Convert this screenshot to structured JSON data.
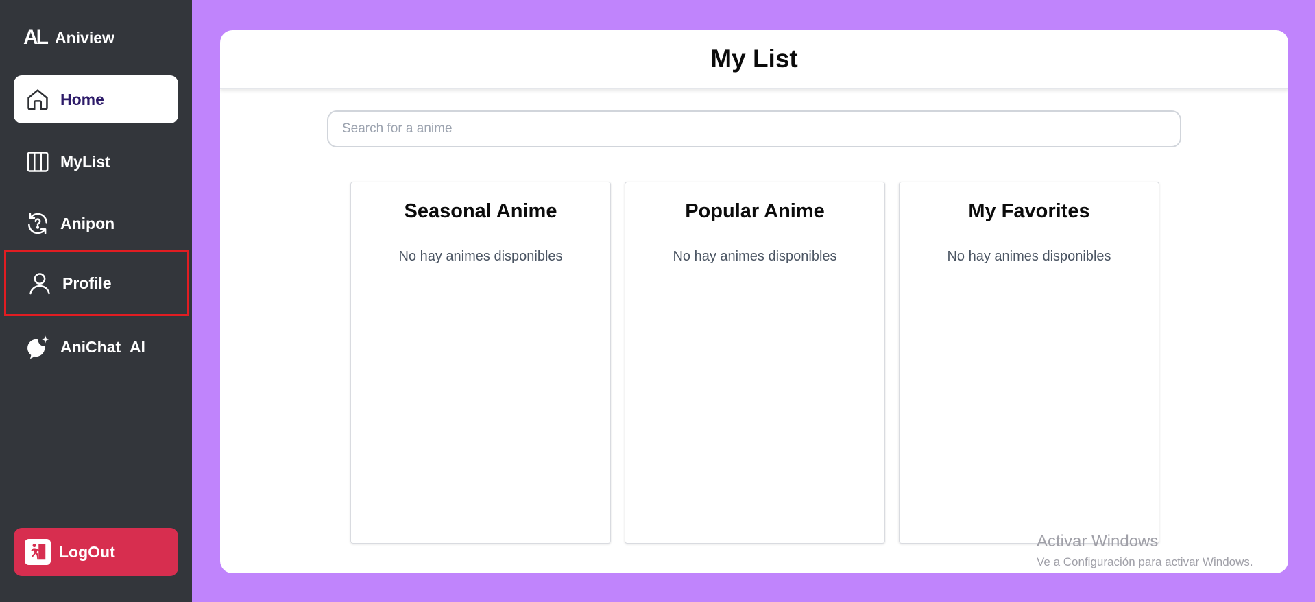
{
  "app": {
    "name": "Aniview",
    "logo_text": "AL"
  },
  "sidebar": {
    "items": [
      {
        "label": "Home",
        "icon": "home-icon"
      },
      {
        "label": "MyList",
        "icon": "columns-icon"
      },
      {
        "label": "Anipon",
        "icon": "refresh-question-icon"
      },
      {
        "label": "Profile",
        "icon": "user-icon"
      },
      {
        "label": "AniChat_AI",
        "icon": "chat-sparkle-icon"
      }
    ],
    "active_item": "Home",
    "highlighted_item": "Profile",
    "logout_label": "LogOut"
  },
  "main": {
    "title": "My List",
    "search": {
      "placeholder": "Search for a anime",
      "value": ""
    },
    "columns": [
      {
        "title": "Seasonal Anime",
        "empty_text": "No hay animes disponibles"
      },
      {
        "title": "Popular Anime",
        "empty_text": "No hay animes disponibles"
      },
      {
        "title": "My Favorites",
        "empty_text": "No hay animes disponibles"
      }
    ]
  },
  "watermark": {
    "line1": "Activar Windows",
    "line2": "Ve a Configuración para activar Windows."
  },
  "colors": {
    "background": "#c084fc",
    "sidebar": "#33363b",
    "logout": "#d72e4f",
    "highlight_border": "#e11d22",
    "active_text": "#2d1b69"
  }
}
